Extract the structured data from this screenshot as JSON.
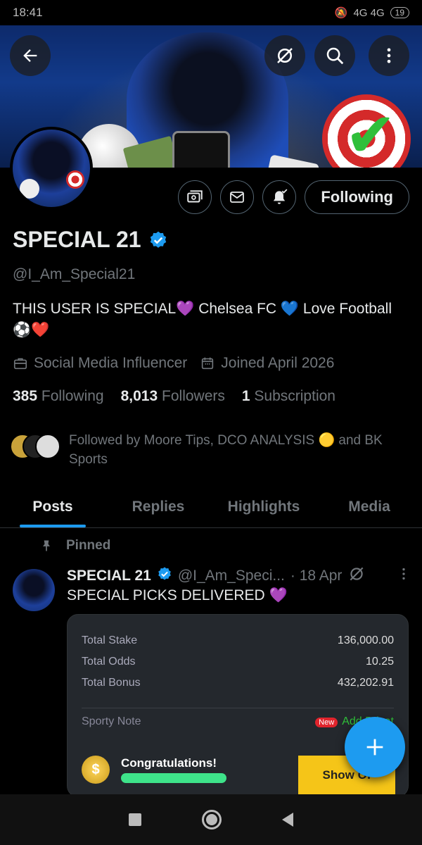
{
  "status_bar": {
    "time": "18:41",
    "network": "4G 4G",
    "battery": "19"
  },
  "profile": {
    "display_name": "SPECIAL 21",
    "handle": "@I_Am_Special21",
    "bio": "THIS USER IS SPECIAL💜 Chelsea FC 💙 Love Football ⚽❤️",
    "category": "Social Media Influencer",
    "joined": "Joined April 2026",
    "following_count": "385",
    "following_label": "Following",
    "followers_count": "8,013",
    "followers_label": "Followers",
    "subscription_count": "1",
    "subscription_label": "Subscription",
    "followed_by_text": "Followed by Moore Tips, DCO ANALYSIS 🟡 and BK Sports",
    "follow_state_label": "Following"
  },
  "tabs": [
    {
      "label": "Posts"
    },
    {
      "label": "Replies"
    },
    {
      "label": "Highlights"
    },
    {
      "label": "Media"
    }
  ],
  "pinned_post": {
    "pinned_label": "Pinned",
    "author_name": "SPECIAL 21",
    "author_handle": "@I_Am_Speci...",
    "date": "· 18 Apr",
    "text": "SPECIAL PICKS DELIVERED 💜",
    "ticket": {
      "rows": [
        {
          "label": "Total Stake",
          "value": "136,000.00"
        },
        {
          "label": "Total Odds",
          "value": "10.25"
        },
        {
          "label": "Total Bonus",
          "value": "432,202.91"
        }
      ],
      "note_label": "Sporty Note",
      "new_badge": "New",
      "add_label": "Add Privat",
      "congrats": "Congratulations!",
      "show_label": "Show Of"
    }
  },
  "colors": {
    "accent": "#1d9bf0",
    "muted": "#71767b",
    "text": "#e7e9ea",
    "background": "#000000"
  },
  "icons": {
    "back": "arrow-left-icon",
    "grok": "grok-icon",
    "search": "search-icon",
    "more": "more-vertical-icon",
    "compose": "plus-icon"
  }
}
